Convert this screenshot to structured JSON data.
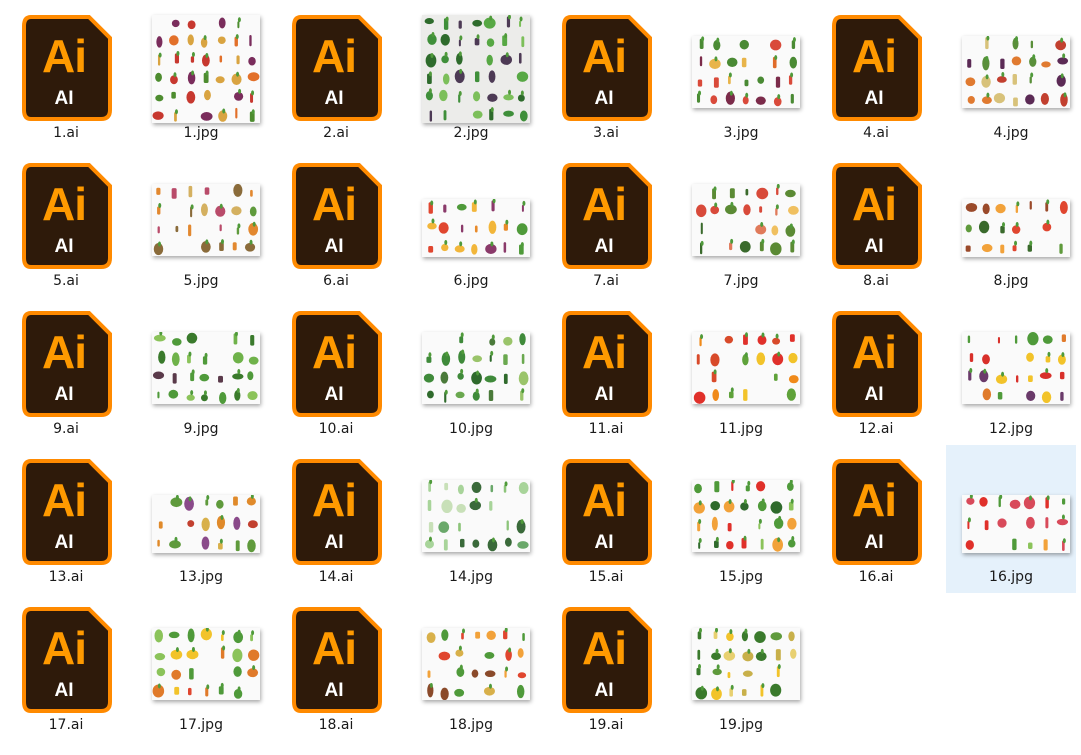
{
  "files": [
    {
      "name": "1.ai",
      "type": "ai"
    },
    {
      "name": "1.jpg",
      "type": "jpg",
      "variant": "sq",
      "palette": [
        "#e2702a",
        "#7a2d5c",
        "#4d8c2f",
        "#c7382f",
        "#d9a441"
      ]
    },
    {
      "name": "2.ai",
      "type": "ai"
    },
    {
      "name": "2.jpg",
      "type": "jpg",
      "variant": "sq",
      "bg": "#ececea",
      "palette": [
        "#3f8f3a",
        "#57a844",
        "#2e6b2c",
        "#4d3a55",
        "#7cbf5a"
      ]
    },
    {
      "name": "3.ai",
      "type": "ai"
    },
    {
      "name": "3.jpg",
      "type": "jpg",
      "variant": "wide",
      "palette": [
        "#e06b2a",
        "#4a8a34",
        "#7b2b4a",
        "#d94a3a",
        "#e8b44a"
      ]
    },
    {
      "name": "4.ai",
      "type": "ai"
    },
    {
      "name": "4.jpg",
      "type": "jpg",
      "variant": "wide",
      "palette": [
        "#e07a30",
        "#5b2a55",
        "#5a8f3a",
        "#d8c27a",
        "#c2402f"
      ]
    },
    {
      "name": "5.ai",
      "type": "ai"
    },
    {
      "name": "5.jpg",
      "type": "jpg",
      "variant": "wide",
      "palette": [
        "#e2882f",
        "#5f9a3c",
        "#b94b6a",
        "#d4b060",
        "#8a6b3a"
      ]
    },
    {
      "name": "6.ai",
      "type": "ai"
    },
    {
      "name": "6.jpg",
      "type": "jpg",
      "variant": "tall",
      "palette": [
        "#e0462f",
        "#f2b63a",
        "#4f9a3a",
        "#8a3a6a",
        "#e88a2a"
      ]
    },
    {
      "name": "7.ai",
      "type": "ai"
    },
    {
      "name": "7.jpg",
      "type": "jpg",
      "variant": "wide",
      "palette": [
        "#5b8a34",
        "#d84a3a",
        "#f0c060",
        "#3a6a2c",
        "#e07a5a"
      ]
    },
    {
      "name": "8.ai",
      "type": "ai"
    },
    {
      "name": "8.jpg",
      "type": "jpg",
      "variant": "tall",
      "palette": [
        "#e0462f",
        "#5f9a3c",
        "#f2a23a",
        "#3a6a2c",
        "#9a4a2a"
      ]
    },
    {
      "name": "9.ai",
      "type": "ai"
    },
    {
      "name": "9.jpg",
      "type": "jpg",
      "variant": "wide",
      "palette": [
        "#4f9a3a",
        "#6fb24a",
        "#3a7a2c",
        "#8bc35a",
        "#5a3a4a"
      ]
    },
    {
      "name": "10.ai",
      "type": "ai"
    },
    {
      "name": "10.jpg",
      "type": "jpg",
      "variant": "wide",
      "palette": [
        "#3f8a3a",
        "#6aa84f",
        "#2f6a2c",
        "#9ac46a",
        "#4a7a3a"
      ]
    },
    {
      "name": "11.ai",
      "type": "ai"
    },
    {
      "name": "11.jpg",
      "type": "jpg",
      "variant": "wide",
      "palette": [
        "#e0302a",
        "#f2c32a",
        "#f08a1a",
        "#5fa23a",
        "#d84a2a"
      ]
    },
    {
      "name": "12.ai",
      "type": "ai"
    },
    {
      "name": "12.jpg",
      "type": "jpg",
      "variant": "wide",
      "palette": [
        "#d8302a",
        "#f2c32a",
        "#4f9a3a",
        "#e07a2a",
        "#6a3a6a"
      ]
    },
    {
      "name": "13.ai",
      "type": "ai"
    },
    {
      "name": "13.jpg",
      "type": "jpg",
      "variant": "tall",
      "palette": [
        "#e08a2a",
        "#8a4a8a",
        "#d8b04a",
        "#c2402f",
        "#5f9a3c"
      ]
    },
    {
      "name": "14.ai",
      "type": "ai"
    },
    {
      "name": "14.jpg",
      "type": "jpg",
      "variant": "wide",
      "palette": [
        "#8cc47a",
        "#a8d49a",
        "#3a6a3a",
        "#6aa86a",
        "#c8e0b8"
      ]
    },
    {
      "name": "15.ai",
      "type": "ai"
    },
    {
      "name": "15.jpg",
      "type": "jpg",
      "variant": "wide",
      "palette": [
        "#4f9a3a",
        "#e0302a",
        "#f2a23a",
        "#2f6a2c",
        "#8bc35a"
      ]
    },
    {
      "name": "16.ai",
      "type": "ai"
    },
    {
      "name": "16.jpg",
      "type": "jpg",
      "variant": "tall",
      "selected": true,
      "palette": [
        "#e0302a",
        "#4f9a3a",
        "#f2a23a",
        "#8bc35a",
        "#d84a5a"
      ]
    },
    {
      "name": "17.ai",
      "type": "ai"
    },
    {
      "name": "17.jpg",
      "type": "jpg",
      "variant": "wide",
      "palette": [
        "#e0462f",
        "#4f9a3a",
        "#f2c32a",
        "#e07a2a",
        "#8bc35a"
      ]
    },
    {
      "name": "18.ai",
      "type": "ai"
    },
    {
      "name": "18.jpg",
      "type": "jpg",
      "variant": "wide",
      "palette": [
        "#f2a23a",
        "#e0462f",
        "#4f9a3a",
        "#d8b04a",
        "#8a4a2a"
      ]
    },
    {
      "name": "19.ai",
      "type": "ai"
    },
    {
      "name": "19.jpg",
      "type": "jpg",
      "variant": "wide",
      "palette": [
        "#f2c32a",
        "#5f9a3c",
        "#e8d070",
        "#3a7a2c",
        "#c8b04a"
      ]
    }
  ],
  "icon": {
    "big": "Ai",
    "small": "AI",
    "bg": "#2e1a0a",
    "border": "#ff8a00",
    "accent": "#ff9a00"
  },
  "selection_color": "#e5f1fb"
}
